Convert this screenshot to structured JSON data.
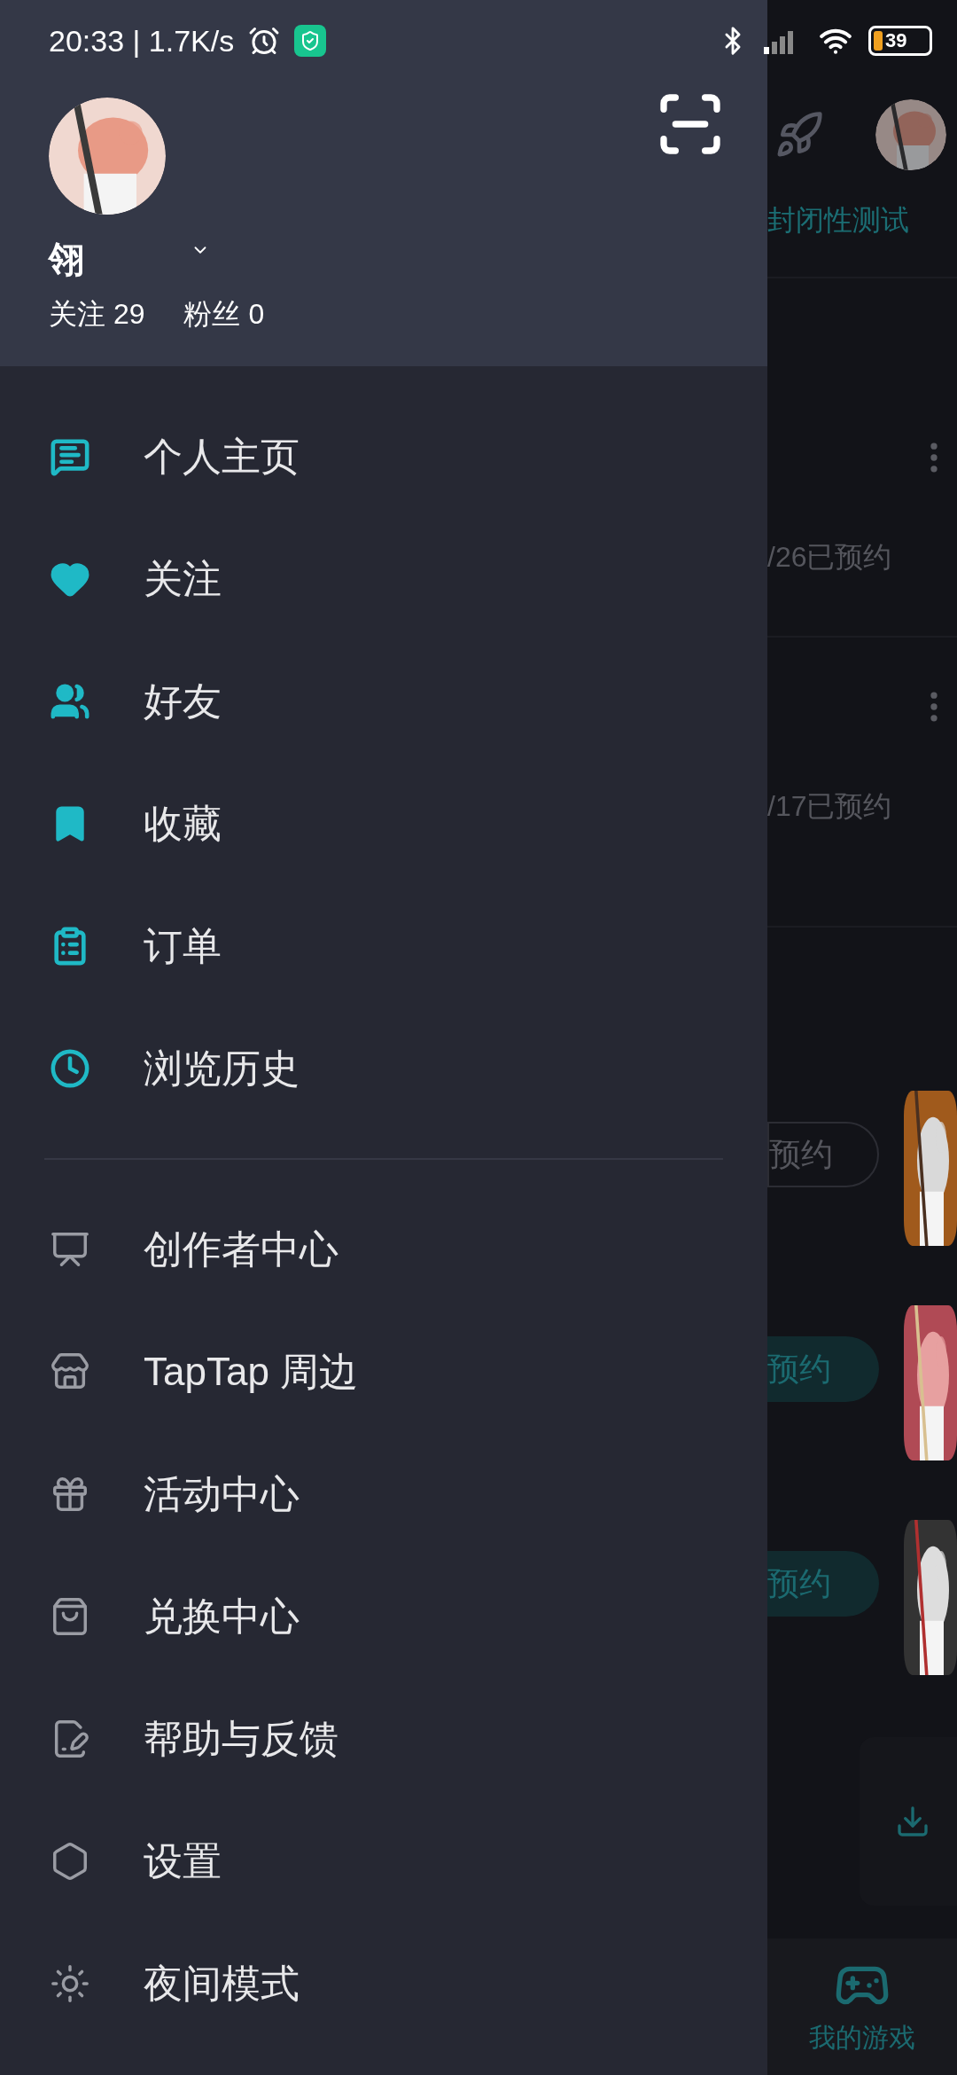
{
  "status_bar": {
    "time": "20:33 | 1.7K/s",
    "battery": "39"
  },
  "profile": {
    "name": "翎",
    "following": "关注 29",
    "followers": "粉丝 0"
  },
  "primary_menu": [
    {
      "label": "个人主页"
    },
    {
      "label": "关注"
    },
    {
      "label": "好友"
    },
    {
      "label": "收藏"
    },
    {
      "label": "订单"
    },
    {
      "label": "浏览历史"
    }
  ],
  "secondary_menu": [
    {
      "label": "创作者中心"
    },
    {
      "label": "TapTap 周边"
    },
    {
      "label": "活动中心"
    },
    {
      "label": "兑换中心"
    },
    {
      "label": "帮助与反馈"
    },
    {
      "label": "设置"
    },
    {
      "label": "夜间模式"
    }
  ],
  "background_page": {
    "tag": "封闭性测试",
    "entries": [
      {
        "date": "/26已预约"
      },
      {
        "date": "/17已预约"
      }
    ],
    "reserve_buttons": [
      {
        "label": "预约",
        "kind": "outlined"
      },
      {
        "label": "预约",
        "kind": "filled"
      },
      {
        "label": "预约",
        "kind": "filled"
      }
    ],
    "bottom_tab": {
      "label": "我的游戏"
    }
  }
}
